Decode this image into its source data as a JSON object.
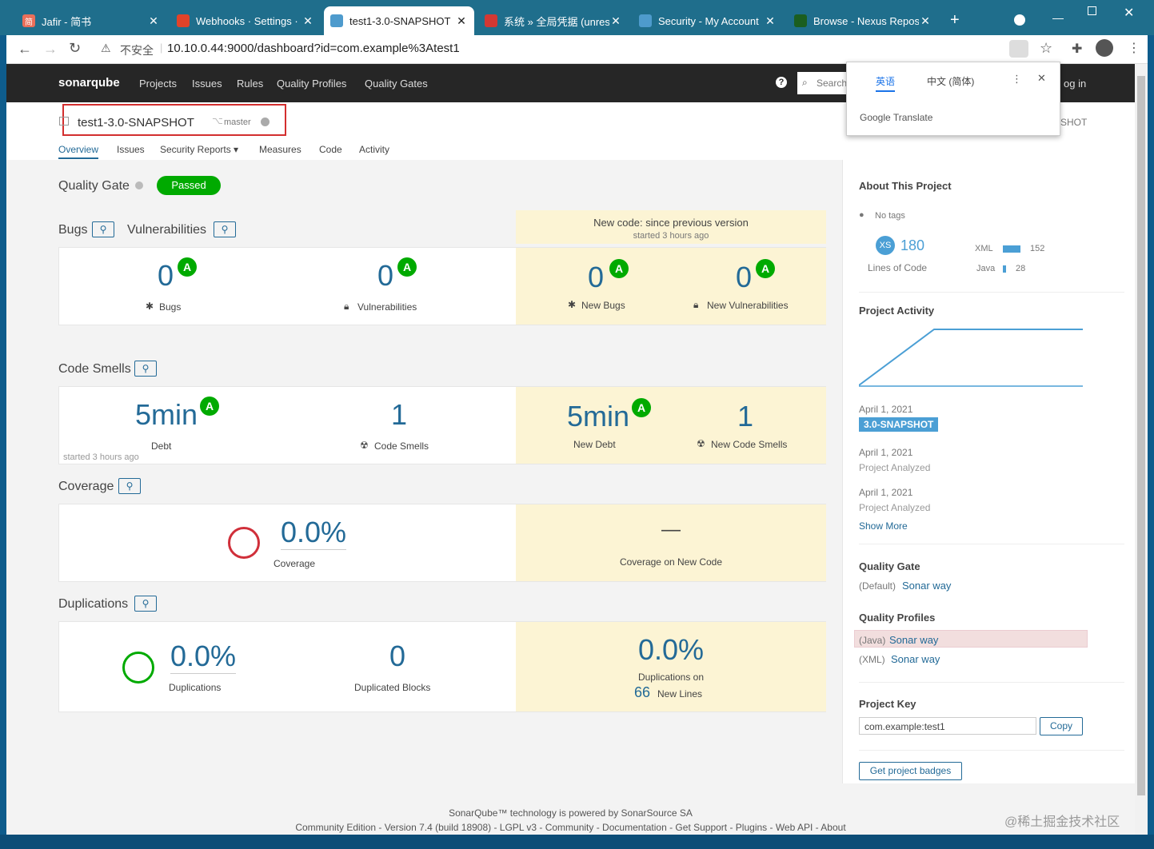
{
  "browser": {
    "tabs": [
      {
        "title": "Jafir - 简书",
        "icon": "jianshu-icon",
        "color": "#ea6f5a",
        "fav": "简"
      },
      {
        "title": "Webhooks · Settings ·",
        "icon": "gitlab-icon",
        "color": "#e24329",
        "fav": ""
      },
      {
        "title": "test1-3.0-SNAPSHOT",
        "icon": "sonarqube-icon",
        "color": "#4e9bcd",
        "fav": ""
      },
      {
        "title": "系统 » 全局凭据 (unrest",
        "icon": "jenkins-icon",
        "color": "#d33833",
        "fav": ""
      },
      {
        "title": "Security - My Account",
        "icon": "sonarqube-icon",
        "color": "#4e9bcd",
        "fav": ""
      },
      {
        "title": "Browse - Nexus Repos",
        "icon": "nexus-icon",
        "color": "#1b5e20",
        "fav": ""
      }
    ],
    "address_security": "不安全",
    "url": "10.10.0.44:9000/dashboard?id=com.example%3Atest1"
  },
  "nav": {
    "logo": "sonarqube",
    "items": [
      "Projects",
      "Issues",
      "Rules",
      "Quality Profiles",
      "Quality Gates"
    ],
    "search_placeholder": "Search",
    "login": "og in"
  },
  "translate": {
    "tab1": "英语",
    "tab2": "中文 (简体)",
    "brand": "Google Translate"
  },
  "project": {
    "name": "test1-3.0-SNAPSHOT",
    "branch": "master",
    "version_cut": "SHOT",
    "tabs": [
      "Overview",
      "Issues",
      "Security Reports ▾",
      "Measures",
      "Code",
      "Activity"
    ]
  },
  "quality_gate": {
    "label": "Quality Gate",
    "status": "Passed"
  },
  "new_code": {
    "title": "New code: since previous version",
    "sub": "started 3 hours ago"
  },
  "bugs": {
    "title": "Bugs",
    "vuln_title": "Vulnerabilities",
    "bugs": "0",
    "bugs_rating": "A",
    "bugs_label": "Bugs",
    "vulns": "0",
    "vulns_rating": "A",
    "vulns_label": "Vulnerabilities",
    "new_bugs": "0",
    "new_bugs_rating": "A",
    "new_bugs_label": "New Bugs",
    "new_vulns": "0",
    "new_vulns_rating": "A",
    "new_vulns_label": "New Vulnerabilities"
  },
  "smells": {
    "title": "Code Smells",
    "debt": "5min",
    "debt_rating": "A",
    "debt_label": "Debt",
    "started": "started 3 hours ago",
    "smells": "1",
    "smells_label": "Code Smells",
    "new_debt": "5min",
    "new_debt_rating": "A",
    "new_debt_label": "New Debt",
    "new_smells": "1",
    "new_smells_label": "New Code Smells"
  },
  "coverage": {
    "title": "Coverage",
    "value": "0.0%",
    "label": "Coverage",
    "new_value": "—",
    "new_label": "Coverage on New Code"
  },
  "duplications": {
    "title": "Duplications",
    "value": "0.0%",
    "label": "Duplications",
    "blocks": "0",
    "blocks_label": "Duplicated Blocks",
    "new_value": "0.0%",
    "new_label": "Duplications on",
    "new_lines": "66",
    "new_lines_label": "New Lines"
  },
  "sidebar": {
    "about": "About This Project",
    "tags": "No tags",
    "size": "XS",
    "loc": "180",
    "loc_label": "Lines of Code",
    "langs": [
      {
        "name": "XML",
        "value": "152"
      },
      {
        "name": "Java",
        "value": "28"
      }
    ],
    "activity_title": "Project Activity",
    "events": [
      {
        "date": "April 1, 2021",
        "badge": "3.0-SNAPSHOT"
      },
      {
        "date": "April 1, 2021",
        "text": "Project Analyzed"
      },
      {
        "date": "April 1, 2021",
        "text": "Project Analyzed"
      }
    ],
    "show_more": "Show More",
    "qg_title": "Quality Gate",
    "qg_default": "(Default)",
    "qg_name": "Sonar way",
    "qp_title": "Quality Profiles",
    "profiles": [
      {
        "lang": "(Java)",
        "name": "Sonar way"
      },
      {
        "lang": "(XML)",
        "name": "Sonar way"
      }
    ],
    "key_title": "Project Key",
    "key": "com.example:test1",
    "copy": "Copy",
    "badges": "Get project badges"
  },
  "footer": {
    "line1": "SonarQube™ technology is powered by SonarSource SA",
    "line2": "Community Edition - Version 7.4 (build 18908) - LGPL v3 - Community - Documentation - Get Support - Plugins - Web API - About",
    "watermark": "@稀土掘金技术社区"
  }
}
